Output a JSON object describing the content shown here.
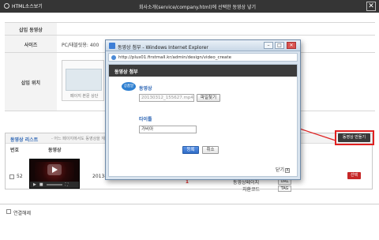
{
  "window": {
    "left_title": "HTML소스보기",
    "center_title": "회사소개(service/company.html)에 선택한 동영상 넣기",
    "close_glyph": "✕"
  },
  "table": {
    "rows": [
      {
        "label": "삽입 동영상",
        "value": ""
      },
      {
        "label": "사이즈",
        "value": "PC/태블릿용: 400"
      },
      {
        "label": "삽입 위치",
        "value": ""
      }
    ],
    "preview_caption": "페이지 본문 상단"
  },
  "list": {
    "title": "동영상 리스트",
    "subtitle": "- 어느 페이지에서도 동영상을 재생",
    "make_button": "동영상 만들기",
    "columns": {
      "num": "번호",
      "video": "동영상"
    },
    "row": {
      "num": "52",
      "date": "2013-",
      "select_button": "선택",
      "detail_page_label": "동영상페이지",
      "url_button": "URL",
      "source_label": "치환코드",
      "tag_button": "TAG"
    }
  },
  "pager": {
    "current": "1"
  },
  "bottom": {
    "checkbox_label": "연결해제"
  },
  "dialog": {
    "title": "동영상 첨부 - Windows Internet Explorer",
    "url": "http://plus01.firstmall.kr/admin/design/video_create",
    "header": "동영상 첨부",
    "icon_text": "상품말",
    "video_label": "동영상",
    "file_value": "20130312_155627.mp4",
    "find_button": "파일찾기",
    "title_label": "타이틀",
    "title_value": "가비아",
    "submit_button": "등록",
    "cancel_button": "취소",
    "close_label": "닫기",
    "close_x": "X",
    "minimize": "–",
    "maximize": "□",
    "close_win": "✕"
  },
  "colors": {
    "highlight": "#e02020",
    "dark_header": "#3b3b3b",
    "accent_blue": "#2f67b5"
  }
}
